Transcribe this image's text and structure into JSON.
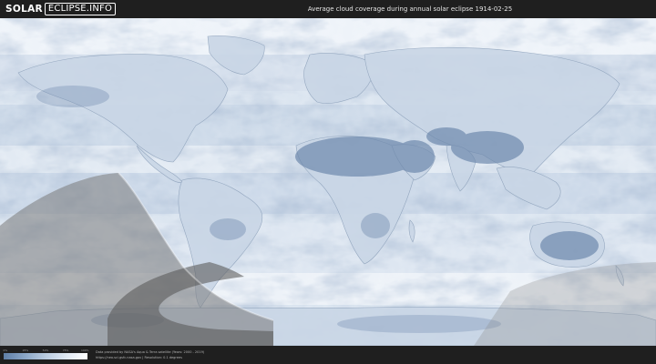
{
  "header": {
    "logo_part1": "SOLAR",
    "logo_part2": "ECLIPSE.INFO",
    "title": "Average cloud coverage during annual solar eclipse 1914-02-25"
  },
  "legend": {
    "ticks": [
      "0%",
      "25%",
      "50%",
      "75%",
      "100%"
    ],
    "colors": [
      "#5f7fa7",
      "#8aa6c6",
      "#b9cbdf",
      "#e0e9f3",
      "#ffffff"
    ]
  },
  "credits": {
    "line1": "Data provided by NASA's Aqua & Terra satellite (Years: 2000 - 2019)",
    "line2": "https://neo.sci.gsfc.nasa.gov | Resolution: 0.1 degrees"
  },
  "colors": {
    "background": "#1e1e1e",
    "cloud_white": "#f2f6fb",
    "clear_sky": "#6e88ac",
    "eclipse_overlay": "#6b6b6b"
  }
}
